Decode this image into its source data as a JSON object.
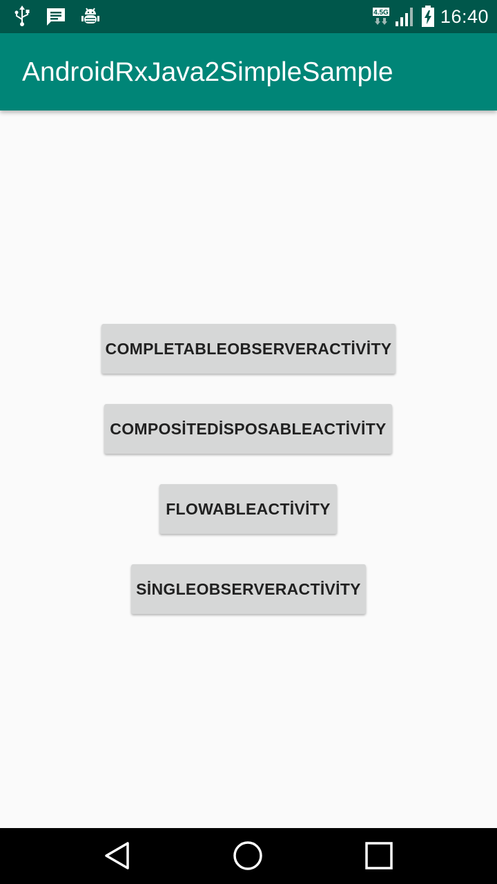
{
  "status_bar": {
    "time": "16:40",
    "network_label": "4.5G",
    "icons_left": [
      "usb-icon",
      "message-icon",
      "android-debug-icon"
    ],
    "icons_right": [
      "network-type-icon",
      "signal-icon",
      "battery-charging-icon"
    ]
  },
  "app_bar": {
    "title": "AndroidRxJava2SimpleSample",
    "color": "#008577",
    "status_bar_color": "#00574b"
  },
  "buttons": [
    {
      "label": "COMPLETABLEOBSERVERACTİVİTY"
    },
    {
      "label": "COMPOSİTEDİSPOSABLEACTİVİTY"
    },
    {
      "label": "FLOWABLEACTİVİTY"
    },
    {
      "label": "SİNGLEOBSERVERACTİVİTY"
    }
  ],
  "nav_bar": {
    "icons": [
      "back-icon",
      "home-icon",
      "recents-icon"
    ]
  }
}
